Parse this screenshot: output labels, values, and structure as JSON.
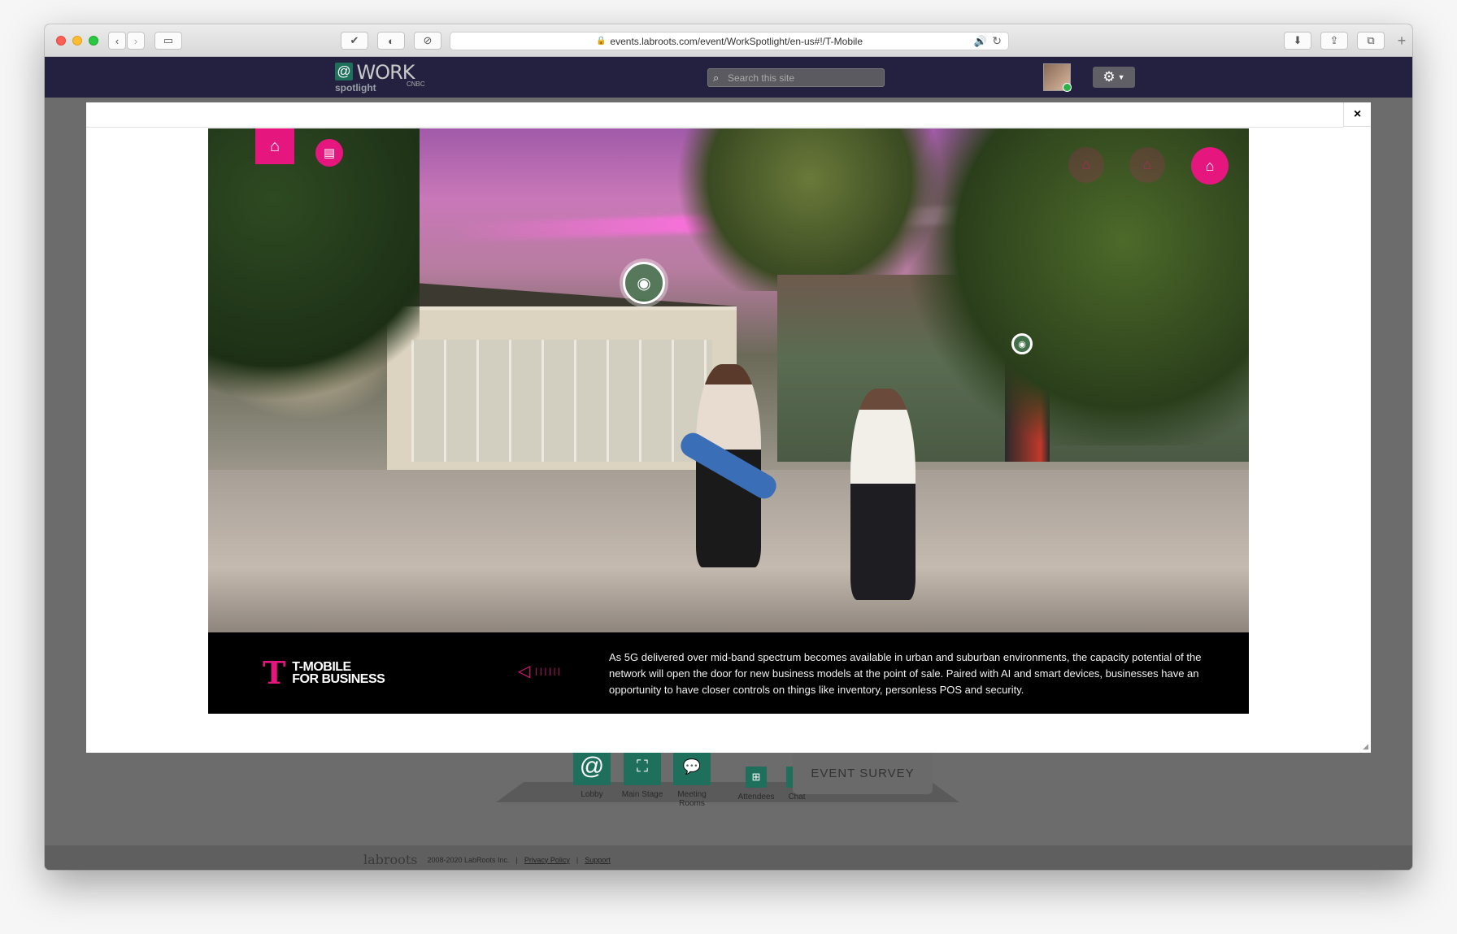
{
  "browser": {
    "url": "events.labroots.com/event/WorkSpotlight/en-us#!/T-Mobile",
    "new_tab": "+"
  },
  "site": {
    "logo_at": "@",
    "logo_work": "WORK",
    "logo_spotlight": "spotlight",
    "logo_cnbc": "CNBC",
    "search_placeholder": "Search this site"
  },
  "modal": {
    "close": "×",
    "brand_mark": "T",
    "brand_line1": "T-MOBILE",
    "brand_line2": "FOR BUSINESS",
    "caption": "As 5G delivered over mid-band spectrum becomes available in urban and suburban environments, the capacity potential of the network will open the door for new business models at the point of sale. Paired with AI and smart devices, businesses have an opportunity to have closer controls on things like inventory, personless POS and security."
  },
  "scene_icons": [
    "home-icon",
    "document-icon",
    "faded-icon",
    "faded-icon",
    "storefront-icon",
    "apple-icon"
  ],
  "bottom_nav": {
    "items": [
      "Lobby",
      "Main Stage",
      "Meeting Rooms",
      "Attendees",
      "Chat"
    ],
    "survey": "EVENT SURVEY"
  },
  "footer": {
    "brand": "labroots",
    "copyright": "2008-2020 LabRoots Inc.",
    "sep": "|",
    "privacy": "Privacy Policy",
    "support": "Support"
  },
  "colors": {
    "accent_magenta": "#e5177f",
    "header_navy": "#232040",
    "nav_green": "#1e6f5c"
  }
}
